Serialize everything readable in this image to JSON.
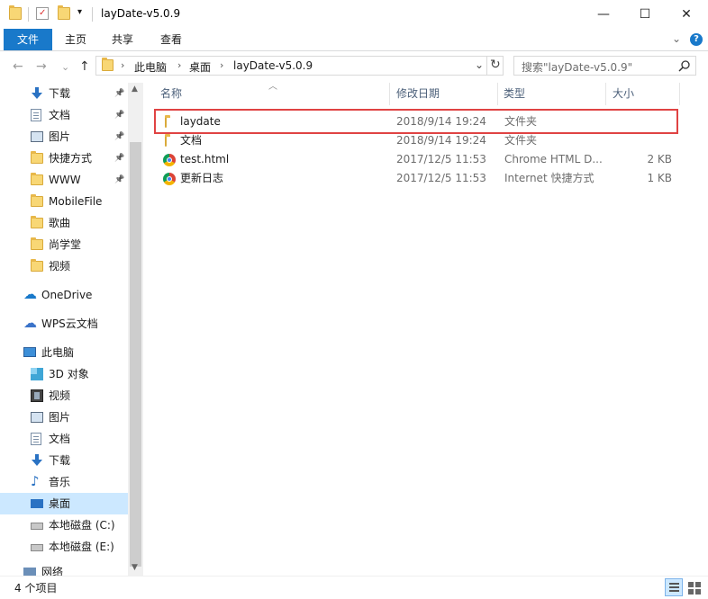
{
  "window": {
    "title": "layDate-v5.0.9",
    "minimize": "—",
    "maximize": "☐",
    "close": "✕"
  },
  "ribbon": {
    "tabs": [
      "文件",
      "主页",
      "共享",
      "查看"
    ],
    "expand": "⌄",
    "help": "?"
  },
  "nav": {
    "back": "←",
    "forward": "→",
    "recent": "⌄",
    "up": "↑",
    "breadcrumb": [
      "此电脑",
      "桌面",
      "layDate-v5.0.9"
    ],
    "refresh": "↻",
    "search_placeholder": "搜索\"layDate-v5.0.9\""
  },
  "sidebar": {
    "quick_access": [
      {
        "label": "下载",
        "icon": "download-icon",
        "pinned": true
      },
      {
        "label": "文档",
        "icon": "document-icon",
        "pinned": true
      },
      {
        "label": "图片",
        "icon": "picture-icon",
        "pinned": true
      },
      {
        "label": "快捷方式",
        "icon": "folder-icon",
        "pinned": true
      },
      {
        "label": "WWW",
        "icon": "folder-icon",
        "pinned": true
      },
      {
        "label": "MobileFile",
        "icon": "folder-icon",
        "pinned": false
      },
      {
        "label": "歌曲",
        "icon": "folder-icon",
        "pinned": false
      },
      {
        "label": "尚学堂",
        "icon": "folder-icon",
        "pinned": false
      },
      {
        "label": "视频",
        "icon": "folder-icon",
        "pinned": false
      }
    ],
    "onedrive": "OneDrive",
    "wps": "WPS云文档",
    "this_pc": "此电脑",
    "pc_items": [
      {
        "label": "3D 对象",
        "icon": "3d-objects-icon"
      },
      {
        "label": "视频",
        "icon": "video-icon"
      },
      {
        "label": "图片",
        "icon": "picture-icon"
      },
      {
        "label": "文档",
        "icon": "document-icon"
      },
      {
        "label": "下载",
        "icon": "download-icon"
      },
      {
        "label": "音乐",
        "icon": "music-icon"
      },
      {
        "label": "桌面",
        "icon": "desktop-icon",
        "selected": true
      },
      {
        "label": "本地磁盘 (C:)",
        "icon": "drive-icon"
      },
      {
        "label": "本地磁盘 (E:)",
        "icon": "drive-icon"
      }
    ],
    "network": "网络"
  },
  "columns": {
    "name": "名称",
    "date": "修改日期",
    "type": "类型",
    "size": "大小"
  },
  "files": [
    {
      "name": "laydate",
      "date": "2018/9/14 19:24",
      "type": "文件夹",
      "size": "",
      "icon": "folder-icon"
    },
    {
      "name": "文档",
      "date": "2018/9/14 19:24",
      "type": "文件夹",
      "size": "",
      "icon": "folder-icon"
    },
    {
      "name": "test.html",
      "date": "2017/12/5 11:53",
      "type": "Chrome HTML D...",
      "size": "2 KB",
      "icon": "chrome-icon"
    },
    {
      "name": "更新日志",
      "date": "2017/12/5 11:53",
      "type": "Internet 快捷方式",
      "size": "1 KB",
      "icon": "chrome-shortcut-icon"
    }
  ],
  "status": {
    "count": "4 个项目"
  },
  "colors": {
    "accent": "#1979ca",
    "selection": "#cce8ff",
    "highlight_border": "#e04343"
  }
}
